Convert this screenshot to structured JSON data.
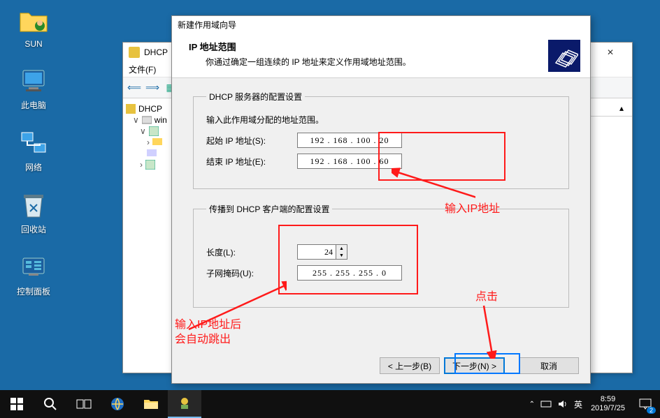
{
  "desktop": {
    "icons": {
      "sun": "SUN",
      "this_pc": "此电脑",
      "network": "网络",
      "recycle": "回收站",
      "control_panel": "控制面板"
    }
  },
  "mmc": {
    "title": "DHCP",
    "menu_file": "文件(F)",
    "tree_root": "DHCP",
    "tree_child": "win"
  },
  "wizard": {
    "window_title": "新建作用域向导",
    "heading": "IP 地址范围",
    "subheading": "你通过确定一组连续的 IP 地址来定义作用域地址范围。",
    "group1_legend": "DHCP 服务器的配置设置",
    "group1_intro": "输入此作用域分配的地址范围。",
    "start_ip_label": "起始 IP 地址(S):",
    "start_ip_value": "192 . 168 . 100 .  20",
    "end_ip_label": "结束 IP 地址(E):",
    "end_ip_value": "192 . 168 . 100 .  60",
    "group2_legend": "传播到 DHCP 客户端的配置设置",
    "length_label": "长度(L):",
    "length_value": "24",
    "mask_label": "子网掩码(U):",
    "mask_value": "255 . 255 . 255 .   0",
    "btn_back": "< 上一步(B)",
    "btn_next": "下一步(N) >",
    "btn_cancel": "取消"
  },
  "annotations": {
    "input_ip": "输入IP地址",
    "click": "点击",
    "auto_jump": "输入IP地址后\n会自动跳出"
  },
  "taskbar": {
    "ime": "英",
    "time": "8:59",
    "date": "2019/7/25",
    "notif_count": "2"
  }
}
